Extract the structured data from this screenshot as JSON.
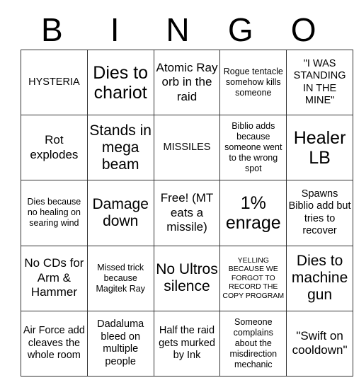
{
  "header": {
    "letters": [
      "B",
      "I",
      "N",
      "G",
      "O"
    ]
  },
  "grid": {
    "columns": 5,
    "rows": 5,
    "cells": [
      {
        "text": "HYSTERIA",
        "size": "fs-m"
      },
      {
        "text": "Dies to chariot",
        "size": "fs-xxl"
      },
      {
        "text": "Atomic Ray orb in the raid",
        "size": "fs-l"
      },
      {
        "text": "Rogue tentacle somehow kills someone",
        "size": "fs-s"
      },
      {
        "text": "\"I WAS STANDING IN THE MINE\"",
        "size": "fs-m"
      },
      {
        "text": "Rot explodes",
        "size": "fs-l"
      },
      {
        "text": "Stands in mega beam",
        "size": "fs-xl"
      },
      {
        "text": "MISSILES",
        "size": "fs-m"
      },
      {
        "text": "Biblio adds because someone went to the wrong spot",
        "size": "fs-s"
      },
      {
        "text": "Healer LB",
        "size": "fs-xxl"
      },
      {
        "text": "Dies because no healing on searing wind",
        "size": "fs-s"
      },
      {
        "text": "Damage down",
        "size": "fs-xl"
      },
      {
        "text": "Free! (MT eats a missile)",
        "size": "fs-l"
      },
      {
        "text": "1% enrage",
        "size": "fs-xxl"
      },
      {
        "text": "Spawns Biblio add but tries to recover",
        "size": "fs-m"
      },
      {
        "text": "No CDs for Arm & Hammer",
        "size": "fs-l"
      },
      {
        "text": "Missed trick because Magitek Ray",
        "size": "fs-s"
      },
      {
        "text": "No Ultros silence",
        "size": "fs-xl"
      },
      {
        "text": "YELLING BECAUSE WE FORGOT TO RECORD THE COPY PROGRAM",
        "size": "fs-xs"
      },
      {
        "text": "Dies to machine gun",
        "size": "fs-xl"
      },
      {
        "text": "Air Force add cleaves the whole room",
        "size": "fs-m"
      },
      {
        "text": "Dadaluma bleed on multiple people",
        "size": "fs-m"
      },
      {
        "text": "Half the raid gets murked by Ink",
        "size": "fs-m"
      },
      {
        "text": "Someone complains about the misdirection mechanic",
        "size": "fs-s"
      },
      {
        "text": "\"Swift on cooldown\"",
        "size": "fs-l"
      }
    ]
  },
  "colors": {
    "background": "#ffffff",
    "text": "#000000",
    "border": "#333333"
  }
}
